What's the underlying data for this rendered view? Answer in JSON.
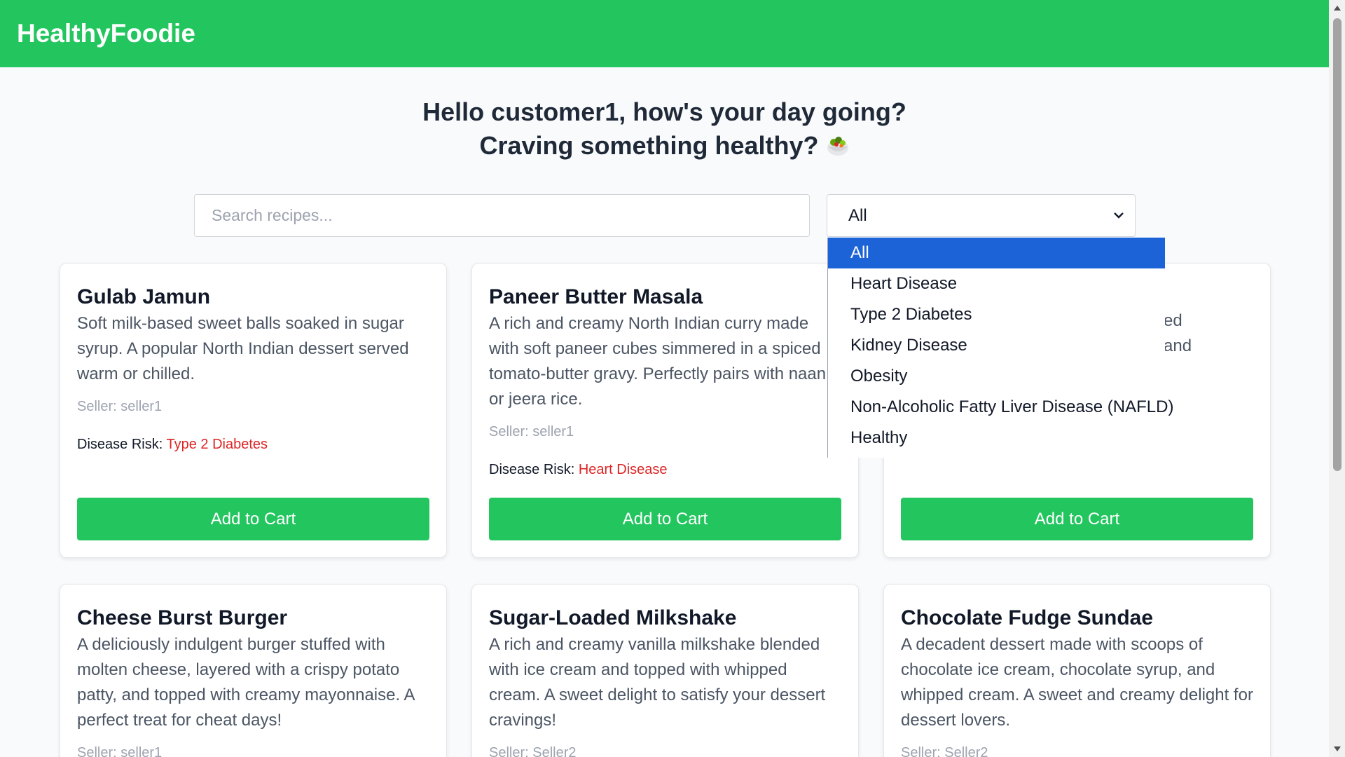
{
  "navbar": {
    "brand": "HealthyFoodie"
  },
  "greeting": {
    "line1": "Hello customer1, how's your day going?",
    "line2": "Craving something healthy?",
    "emoji_icon": "salad-bowl-icon"
  },
  "search": {
    "placeholder": "Search recipes...",
    "value": ""
  },
  "filter": {
    "selected": "All",
    "options": [
      "All",
      "Heart Disease",
      "Type 2 Diabetes",
      "Kidney Disease",
      "Obesity",
      "Non-Alcoholic Fatty Liver Disease (NAFLD)",
      "Healthy"
    ],
    "highlighted": "All",
    "highlight_color": "#1d63d8"
  },
  "colors": {
    "brand_green": "#22c55e",
    "risk_red": "#dc2626"
  },
  "cards": [
    {
      "title": "Gulab Jamun",
      "description": "Soft milk-based sweet balls soaked in sugar syrup. A popular North Indian dessert served warm or chilled.",
      "seller": "Seller: seller1",
      "risk_label": "Disease Risk:",
      "risk_value": "Type 2 Diabetes",
      "button": "Add to Cart"
    },
    {
      "title": "Paneer Butter Masala",
      "description": "A rich and creamy North Indian curry made with soft paneer cubes simmered in a spiced tomato-butter gravy. Perfectly pairs with naan or jeera rice.",
      "seller": "Seller: seller1",
      "risk_label": "Disease Risk:",
      "risk_value": "Heart Disease",
      "button": "Add to Cart"
    },
    {
      "partial_text_1": "ed",
      "partial_text_2": "and",
      "button": "Add to Cart"
    },
    {
      "title": "Cheese Burst Burger",
      "description": "A deliciously indulgent burger stuffed with molten cheese, layered with a crispy potato patty, and topped with creamy mayonnaise. A perfect treat for cheat days!",
      "seller": "Seller: seller1"
    },
    {
      "title": "Sugar-Loaded Milkshake",
      "description": "A rich and creamy vanilla milkshake blended with ice cream and topped with whipped cream. A sweet delight to satisfy your dessert cravings!",
      "seller": "Seller: Seller2"
    },
    {
      "title": "Chocolate Fudge Sundae",
      "description": "A decadent dessert made with scoops of chocolate ice cream, chocolate syrup, and whipped cream. A sweet and creamy delight for dessert lovers.",
      "seller": "Seller: Seller2"
    }
  ]
}
